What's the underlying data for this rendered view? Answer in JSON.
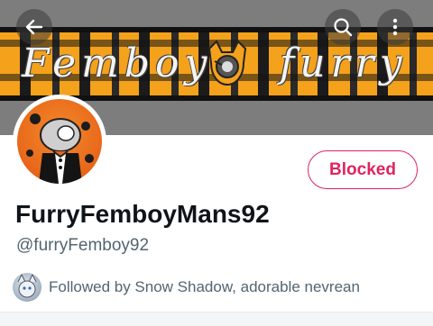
{
  "banner": {
    "text_left": "Femboy",
    "text_right": "furry"
  },
  "topbar": {
    "back_icon": "arrow-left-icon",
    "search_icon": "search-icon",
    "more_icon": "more-vertical-icon"
  },
  "profile": {
    "display_name": "FurryFemboyMans92",
    "handle": "@furryFemboy92",
    "status_button": "Blocked",
    "followed_by": "Followed by Snow Shadow, adorable nevrean"
  },
  "colors": {
    "blocked_red": "#e0245e",
    "secondary_text": "#536471",
    "banner_orange": "#f4a11c"
  }
}
